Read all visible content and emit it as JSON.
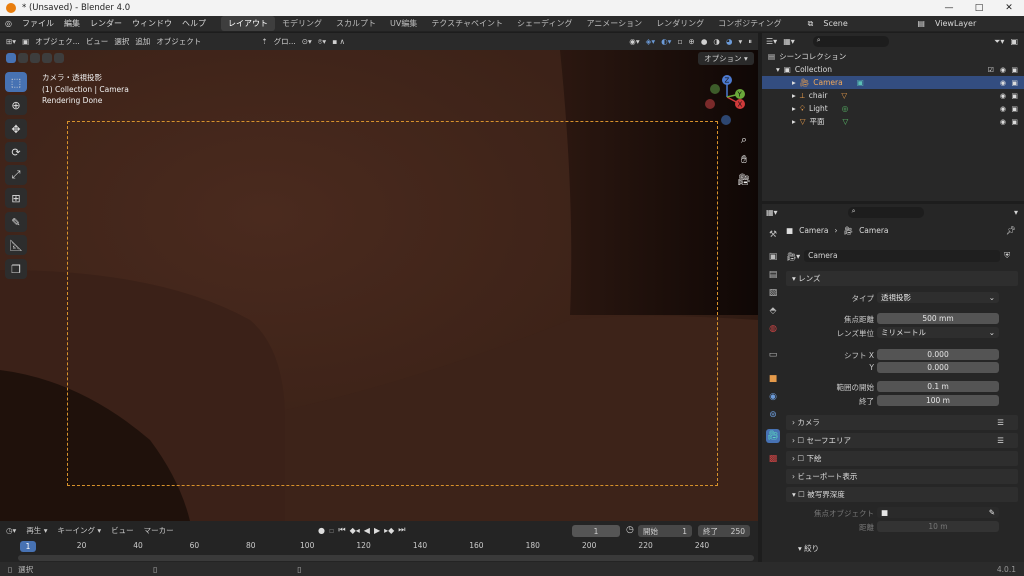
{
  "titlebar": {
    "title": "* (Unsaved) - Blender 4.0",
    "minimize": "—",
    "maximize": "□",
    "close": "✕"
  },
  "menu": {
    "items": [
      "ファイル",
      "編集",
      "レンダー",
      "ウィンドウ",
      "ヘルプ"
    ],
    "workspaces": [
      "レイアウト",
      "モデリング",
      "スカルプト",
      "UV編集",
      "テクスチャペイント",
      "シェーディング",
      "アニメーション",
      "レンダリング",
      "コンポジティング"
    ],
    "active_workspace": "レイアウト",
    "scene": "Scene",
    "view_layer": "ViewLayer"
  },
  "viewport_header": {
    "mode": "オブジェク...",
    "menus": [
      "ビュー",
      "選択",
      "追加",
      "オブジェクト"
    ],
    "transform": "グロ...",
    "options": "オプション"
  },
  "viewport": {
    "info_line1": "カメラ・透視投影",
    "info_line2": "(1) Collection | Camera",
    "info_line3": "Rendering Done",
    "gizmo_x": "X",
    "gizmo_y": "Y",
    "gizmo_z": "Z"
  },
  "tools": [
    "select-box",
    "cursor",
    "move",
    "rotate",
    "scale",
    "transform",
    "annotate",
    "measure",
    "add-cube"
  ],
  "timeline": {
    "menus": [
      "再生",
      "キーイング",
      "ビュー",
      "マーカー"
    ],
    "current_frame": "1",
    "start_label": "開始",
    "start": "1",
    "end_label": "終了",
    "end": "250",
    "ticks": [
      "1",
      "20",
      "40",
      "60",
      "80",
      "100",
      "120",
      "140",
      "160",
      "180",
      "200",
      "220",
      "240"
    ]
  },
  "outliner": {
    "scene_collection": "シーンコレクション",
    "collection": "Collection",
    "objects": [
      {
        "name": "Camera",
        "selected": true
      },
      {
        "name": "chair",
        "selected": false
      },
      {
        "name": "Light",
        "selected": false
      },
      {
        "name": "平面",
        "selected": false
      }
    ]
  },
  "properties": {
    "breadcrumb_1": "Camera",
    "breadcrumb_2": "Camera",
    "data_name": "Camera",
    "lens_panel": "レンズ",
    "type_label": "タイプ",
    "type_value": "透視投影",
    "focal_label": "焦点距離",
    "focal_value": "500 mm",
    "unit_label": "レンズ単位",
    "unit_value": "ミリメートル",
    "shiftx_label": "シフト X",
    "shiftx_value": "0.000",
    "shifty_label": "Y",
    "shifty_value": "0.000",
    "clip_start_label": "範囲の開始",
    "clip_start_value": "0.1 m",
    "clip_end_label": "終了",
    "clip_end_value": "100 m",
    "panel_camera": "カメラ",
    "panel_safe": "セーフエリア",
    "panel_bg": "下絵",
    "panel_display": "ビューポート表示",
    "panel_dof": "被写界深度",
    "focus_obj_label": "焦点オブジェクト",
    "distance_label": "距離",
    "distance_value": "10 m",
    "aperture": "絞り"
  },
  "statusbar": {
    "select": "選択",
    "version": "4.0.1"
  },
  "colors": {
    "accent": "#4772b3",
    "camera_frame": "#d8922b",
    "selected_row": "#334d80"
  }
}
